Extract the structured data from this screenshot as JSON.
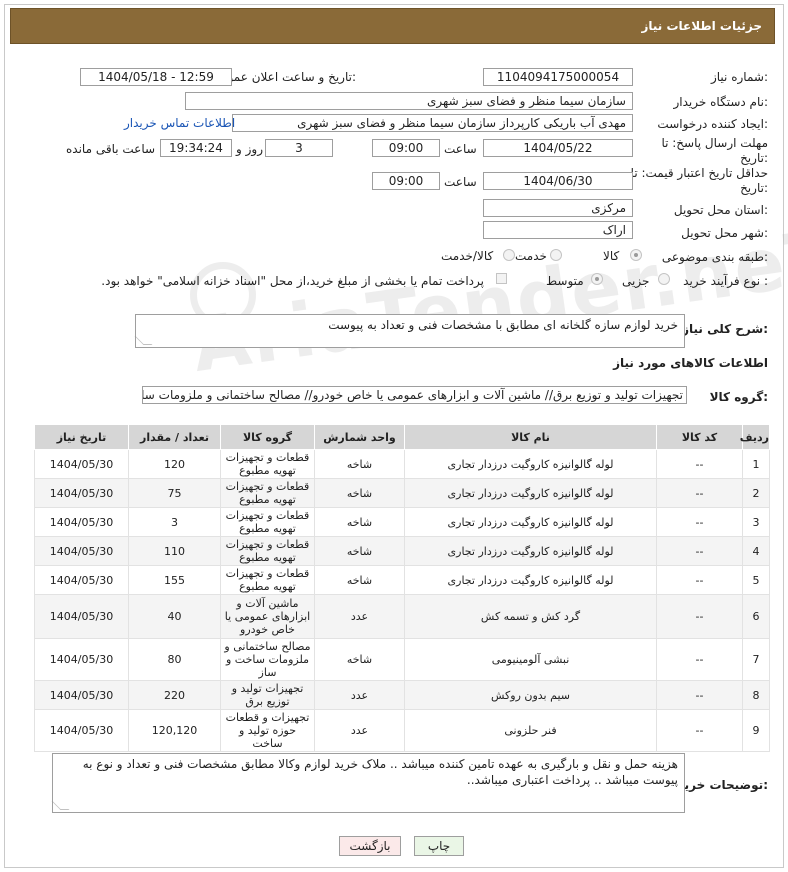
{
  "header": {
    "title": "جزئیات اطلاعات نیاز"
  },
  "fields": {
    "need_number_label": "شماره نیاز:",
    "need_number": "1104094175000054",
    "announce_label": "تاریخ و ساعت اعلان عمومی:",
    "announce_value": "1404/05/18 - 12:59",
    "buyer_label": "نام دستگاه خریدار:",
    "buyer_value": "سازمان سیما منظر و فضای سبز شهری",
    "creator_label": "ایجاد کننده درخواست:",
    "creator_value": "مهدی آب باریکی کارپرداز سازمان سیما منظر و فضای سبز شهری",
    "contact_link": "اطلاعات تماس خریدار",
    "reply_deadline_label": "مهلت ارسال پاسخ: تا تاریخ:",
    "reply_date": "1404/05/22",
    "time_label": "ساعت",
    "reply_time": "09:00",
    "days_value": "3",
    "days_label": "روز و",
    "remaining_time": "19:34:24",
    "remaining_label": "ساعت باقی مانده",
    "price_deadline_label": "حداقل تاریخ اعتبار قیمت: تا تاریخ:",
    "price_date": "1404/06/30",
    "price_time": "09:00",
    "province_label": "استان محل تحویل:",
    "province_value": "مرکزی",
    "city_label": "شهر محل تحویل:",
    "city_value": "اراک",
    "category_label": "طبقه بندی موضوعی:",
    "category_options": [
      "کالا",
      "خدمت",
      "کالا/خدمت"
    ],
    "process_label": "نوع فرآیند خرید :",
    "process_options": [
      "جزیی",
      "متوسط"
    ],
    "payment_note": "پرداخت تمام یا بخشی از مبلغ خرید،از محل \"اسناد خزانه اسلامی\" خواهد بود.",
    "description_label": "شرح کلی نیاز:",
    "description_value": "خرید لوازم سازه گلخانه ای مطابق با مشخصات فنی و تعداد به پیوست",
    "goods_info_title": "اطلاعات کالاهای مورد نیاز",
    "goods_group_label": "گروه کالا:",
    "goods_group_value": "تجهیزات تولید و توزیع برق//  ماشین آلات و ابزارهای عمومی یا خاص خودرو// مصالح ساختمانی و ملزومات ساخ",
    "buyer_notes_label": "توضیحات خریدار:",
    "buyer_notes_value": "هزینه حمل و نقل و بارگیری به عهده تامین کننده میباشد .. ملاک خرید لوازم وکالا مطابق مشخصات فنی و تعداد و نوع به پیوست میباشد .. پرداخت اعتباری میباشد.."
  },
  "watermark": "AriaTender.neT",
  "table": {
    "headers": [
      "ردیف",
      "کد کالا",
      "نام کالا",
      "واحد شمارش",
      "گروه کالا",
      "تعداد / مقدار",
      "تاریخ نیاز"
    ],
    "rows": [
      [
        "1",
        "--",
        "لوله گالوانیزه کاروگیت درزدار تجاری",
        "شاخه",
        "قطعات و تجهیزات تهویه مطبوع",
        "120",
        "1404/05/30"
      ],
      [
        "2",
        "--",
        "لوله گالوانیزه کاروگیت درزدار تجاری",
        "شاخه",
        "قطعات و تجهیزات تهویه مطبوع",
        "75",
        "1404/05/30"
      ],
      [
        "3",
        "--",
        "لوله گالوانیزه کاروگیت درزدار تجاری",
        "شاخه",
        "قطعات و تجهیزات تهویه مطبوع",
        "3",
        "1404/05/30"
      ],
      [
        "4",
        "--",
        "لوله گالوانیزه کاروگیت درزدار تجاری",
        "شاخه",
        "قطعات و تجهیزات تهویه مطبوع",
        "110",
        "1404/05/30"
      ],
      [
        "5",
        "--",
        "لوله گالوانیزه کاروگیت درزدار تجاری",
        "شاخه",
        "قطعات و تجهیزات تهویه مطبوع",
        "155",
        "1404/05/30"
      ],
      [
        "6",
        "--",
        "گرد کش و تسمه کش",
        "عدد",
        "ماشین آلات و ابزارهای عمومی یا خاص خودرو",
        "40",
        "1404/05/30"
      ],
      [
        "7",
        "--",
        "نبشی آلومینیومی",
        "شاخه",
        "مصالح ساختمانی و ملزومات ساخت و ساز",
        "80",
        "1404/05/30"
      ],
      [
        "8",
        "--",
        "سیم بدون روکش",
        "عدد",
        "تجهیزات تولید و توزیع برق",
        "220",
        "1404/05/30"
      ],
      [
        "9",
        "--",
        "فنر حلزونی",
        "عدد",
        "تجهیزات و قطعات حوزه تولید و ساخت",
        "120,120",
        "1404/05/30"
      ]
    ]
  },
  "buttons": {
    "print": "چاپ",
    "back": "بازگشت"
  }
}
